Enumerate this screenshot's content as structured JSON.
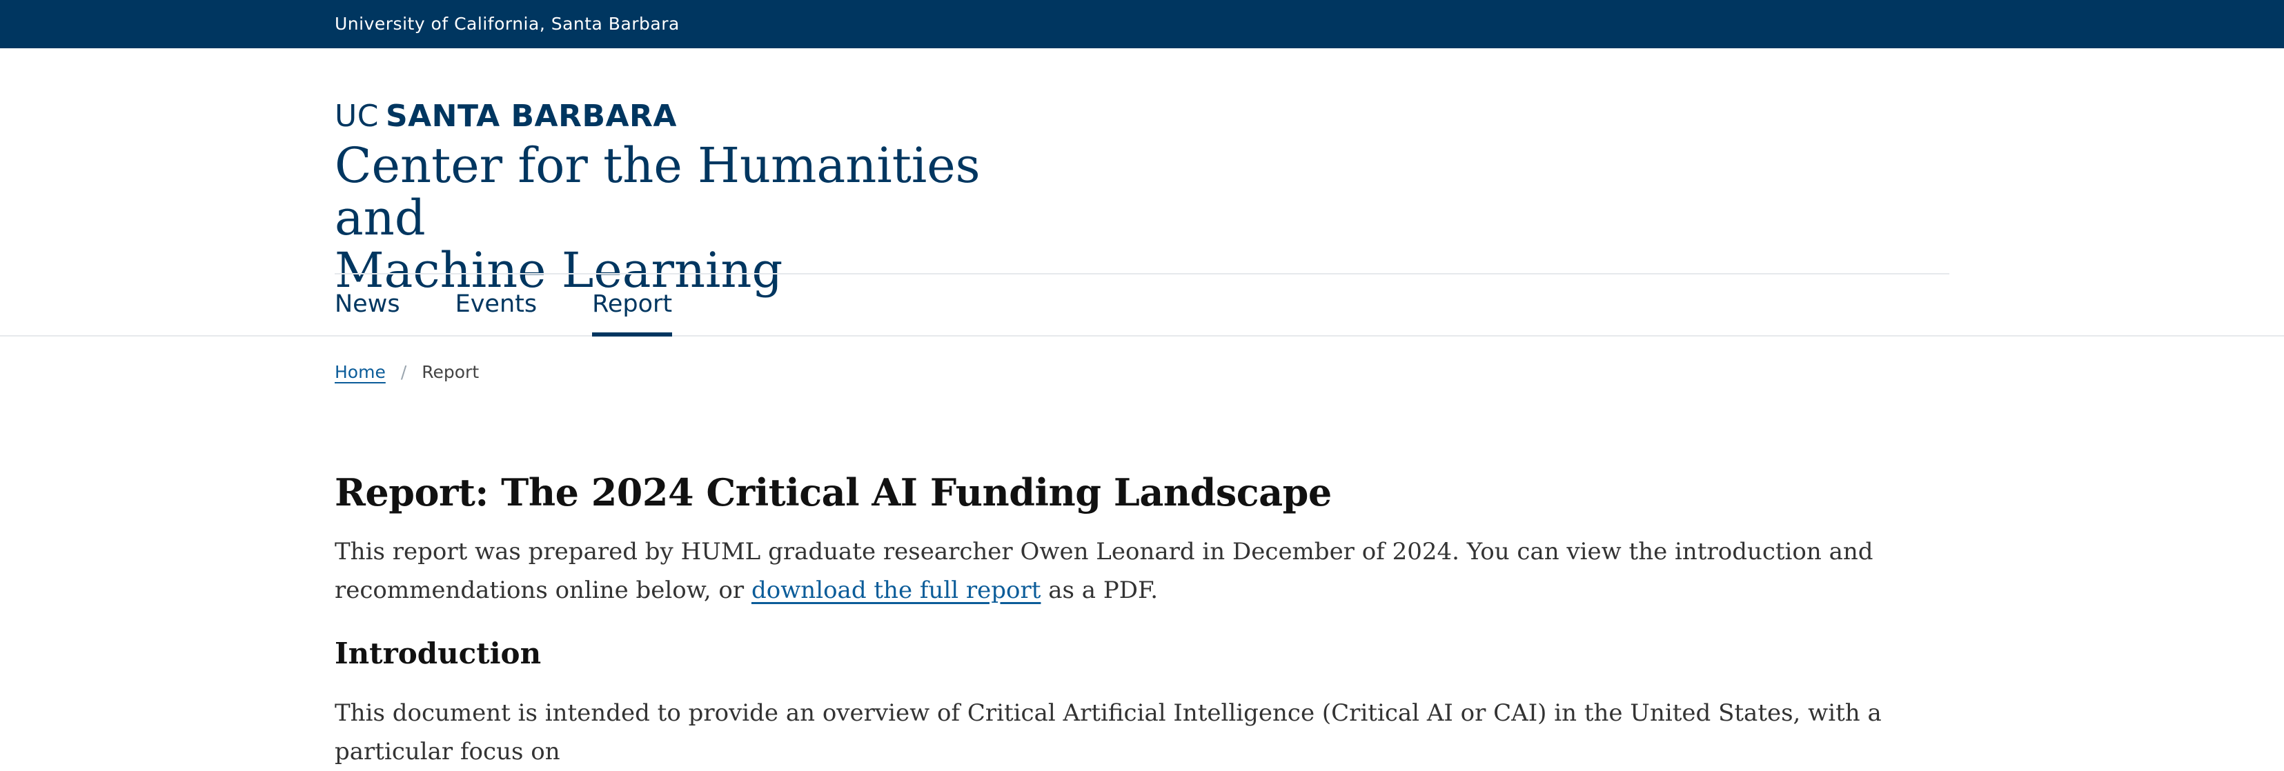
{
  "topbar": {
    "text": "University of California, Santa Barbara"
  },
  "brand": {
    "logo_uc": "UC",
    "logo_name": "SANTA BARBARA",
    "title_line1": "Center for the Humanities and",
    "title_line2": "Machine Learning"
  },
  "nav": {
    "items": [
      {
        "label": "News"
      },
      {
        "label": "Events"
      },
      {
        "label": "Report"
      }
    ],
    "active": "Report"
  },
  "breadcrumb": {
    "home": "Home",
    "separator": "/",
    "current": "Report"
  },
  "content": {
    "title": "Report: The 2024 Critical AI Funding Landscape",
    "lead_before_link": "This report was prepared by HUML graduate researcher Owen Leonard in December of 2024. You can view the introduction and recommendations online below, or ",
    "lead_link": "download the full report",
    "lead_after_link": " as a PDF.",
    "intro_heading": "Introduction",
    "intro_text": "This document is intended to provide an overview of Critical Artificial Intelligence (Critical AI or CAI) in the United States, with a particular focus on"
  },
  "colors": {
    "brand_navy": "#003660",
    "link_blue": "#0b5c99",
    "heading": "#111111",
    "body_text": "#333333"
  }
}
